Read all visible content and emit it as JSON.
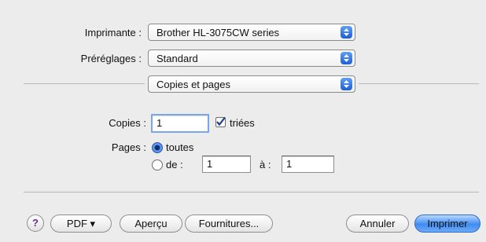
{
  "printer": {
    "label": "Imprimante :",
    "value": "Brother HL-3075CW series"
  },
  "presets": {
    "label": "Préréglages :",
    "value": "Standard"
  },
  "panel": {
    "value": "Copies et pages"
  },
  "copies": {
    "label": "Copies :",
    "value": "1",
    "collated_label": "triées",
    "collated_checked": true
  },
  "pages": {
    "label": "Pages :",
    "all_label": "toutes",
    "from_label": "de :",
    "from_value": "1",
    "to_label": "à :",
    "to_value": "1",
    "selected": "all"
  },
  "footer": {
    "help_label": "?",
    "pdf_label": "PDF ▾",
    "preview_label": "Aperçu",
    "supplies_label": "Fournitures...",
    "cancel_label": "Annuler",
    "print_label": "Imprimer"
  },
  "colors": {
    "accent": "#3f8cf2",
    "dialog_bg": "#ececec"
  }
}
